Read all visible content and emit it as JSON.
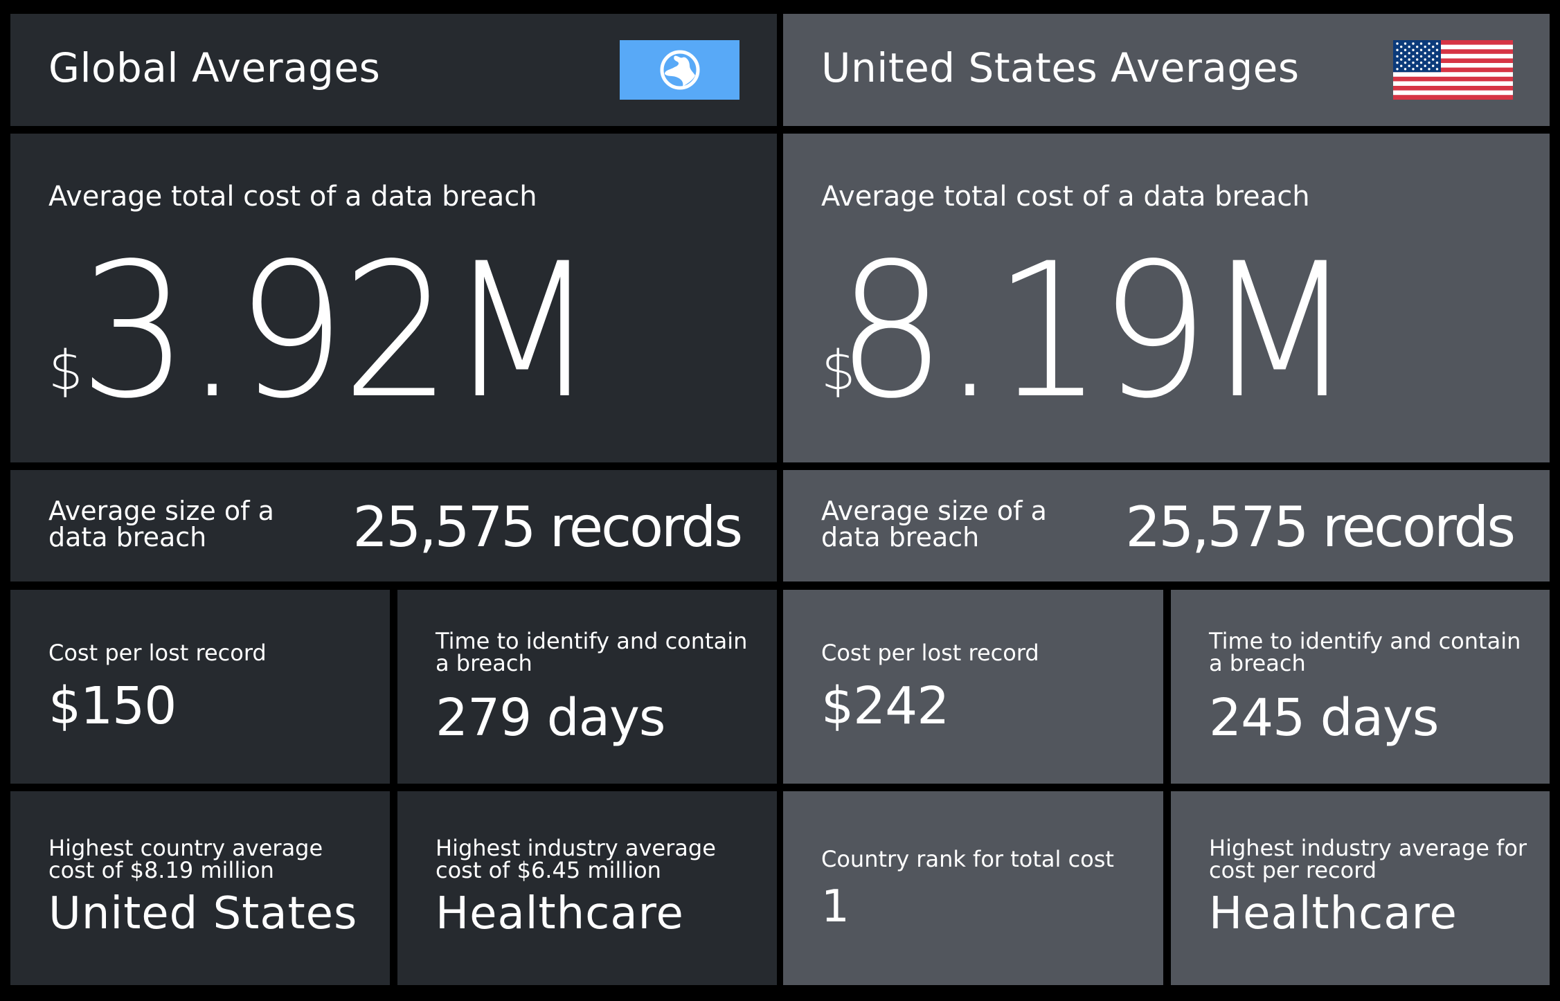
{
  "global": {
    "header": {
      "title": "Global Averages",
      "icon": "globe-icon",
      "icon_bg": "#58a9f7"
    },
    "total_cost": {
      "label": "Average total cost of a data breach",
      "currency": "$",
      "value": "3.92M"
    },
    "records": {
      "label": "Average size of a data breach",
      "value": "25,575 records"
    },
    "cost_per_record": {
      "label": "Cost per lost record",
      "value": "$150"
    },
    "time_to_contain": {
      "label": "Time to identify and contain a breach",
      "value": "279 days"
    },
    "highest_country": {
      "label": "Highest country average cost of $8.19 million",
      "value": "United States"
    },
    "highest_industry": {
      "label": "Highest industry average cost of $6.45 million",
      "value": "Healthcare"
    },
    "panel_color": "#262a2f"
  },
  "us": {
    "header": {
      "title": "United States Averages",
      "icon": "us-flag-icon"
    },
    "total_cost": {
      "label": "Average total cost of a data breach",
      "currency": "$",
      "value": "8.19M"
    },
    "records": {
      "label": "Average size of a data breach",
      "value": "25,575 records"
    },
    "cost_per_record": {
      "label": "Cost per lost record",
      "value": "$242"
    },
    "time_to_contain": {
      "label": "Time to identify and contain a breach",
      "value": "245 days"
    },
    "country_rank": {
      "label": "Country rank for total cost",
      "value": "1"
    },
    "highest_industry_per_record": {
      "label": "Highest industry average for cost per record",
      "value": "Healthcare"
    },
    "panel_color": "#52565d"
  }
}
